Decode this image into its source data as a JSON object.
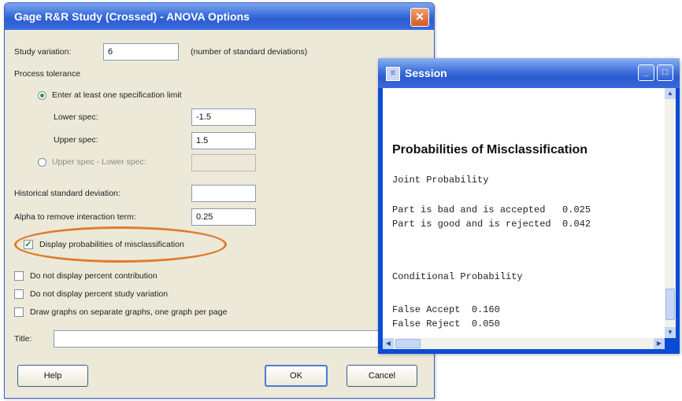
{
  "dialog": {
    "title": "Gage R&R Study (Crossed) - ANOVA Options",
    "close_glyph": "✕",
    "study_variation_label": "Study variation:",
    "study_variation_value": "6",
    "study_variation_note": "(number of standard deviations)",
    "process_tolerance_label": "Process tolerance",
    "radio_spec_limit_label": "Enter at least one specification limit",
    "lower_spec_label": "Lower spec:",
    "lower_spec_value": "-1.5",
    "upper_spec_label": "Upper spec:",
    "upper_spec_value": "1.5",
    "radio_upper_minus_lower_label": "Upper spec - Lower spec:",
    "historical_sd_label": "Historical standard deviation:",
    "alpha_label": "Alpha to remove interaction term:",
    "alpha_value": "0.25",
    "cb_misclassification_label": "Display probabilities of misclassification",
    "cb_no_percent_contribution_label": "Do not display percent contribution",
    "cb_no_percent_study_label": "Do not display percent study variation",
    "cb_separate_graphs_label": "Draw graphs on separate graphs, one graph per page",
    "title_label": "Title:",
    "help_button": "Help",
    "ok_button": "OK",
    "cancel_button": "Cancel"
  },
  "session": {
    "title": "Session",
    "icon_glyph": "≡",
    "min_glyph": "_",
    "max_glyph": "□",
    "heading": "Probabilities of Misclassification",
    "joint_label": "Joint Probability",
    "joint_rows": [
      "Part is bad and is accepted   0.025",
      "Part is good and is rejected  0.042"
    ],
    "conditional_label": "Conditional Probability",
    "conditional_rows": [
      "False Accept  0.160",
      "False Reject  0.050"
    ],
    "scroll_up": "▲",
    "scroll_down": "▼",
    "scroll_left": "◀",
    "scroll_right": "▶"
  },
  "colors": {
    "highlight_oval": "#e07a2e",
    "titlebar": "#2c5ecf",
    "dialog_bg": "#ece9d8"
  }
}
